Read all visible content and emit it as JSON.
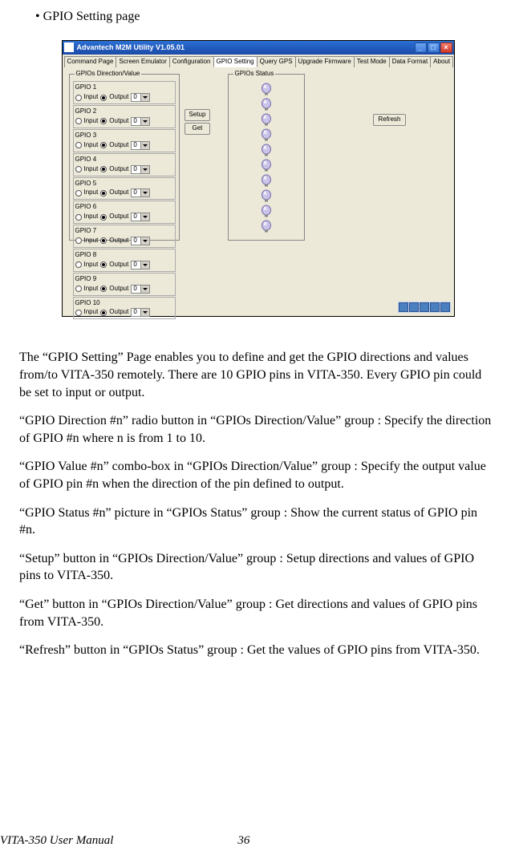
{
  "bullet_heading": "•  GPIO Setting page",
  "window": {
    "title": "Advantech M2M Utility V1.05.01",
    "tabs": [
      "Command Page",
      "Screen Emulator",
      "Configuration",
      "GPIO Setting",
      "Query GPS",
      "Upgrade Firmware",
      "Test Mode",
      "Data Format",
      "About"
    ],
    "active_tab_index": 3,
    "group_direction": {
      "title": "GPIOs Direction/Value",
      "rows": [
        {
          "label": "GPIO 1",
          "input": "Input",
          "output": "Output",
          "value": "0"
        },
        {
          "label": "GPIO 2",
          "input": "Input",
          "output": "Output",
          "value": "0"
        },
        {
          "label": "GPIO 3",
          "input": "Input",
          "output": "Output",
          "value": "0"
        },
        {
          "label": "GPIO 4",
          "input": "Input",
          "output": "Output",
          "value": "0"
        },
        {
          "label": "GPIO 5",
          "input": "Input",
          "output": "Output",
          "value": "0"
        },
        {
          "label": "GPIO 6",
          "input": "Input",
          "output": "Output",
          "value": "0"
        },
        {
          "label": "GPIO 7",
          "input": "Input",
          "output": "Output",
          "value": "0"
        },
        {
          "label": "GPIO 8",
          "input": "Input",
          "output": "Output",
          "value": "0"
        },
        {
          "label": "GPIO 9",
          "input": "Input",
          "output": "Output",
          "value": "0"
        },
        {
          "label": "GPIO 10",
          "input": "Input",
          "output": "Output",
          "value": "0"
        }
      ]
    },
    "setup_label": "Setup",
    "get_label": "Get",
    "group_status": {
      "title": "GPIOs Status"
    },
    "refresh_label": "Refresh"
  },
  "paragraphs": {
    "p1": "The “GPIO Setting” Page enables you to define and get the GPIO direc­tions and values from/to VITA-350 remotely. There are 10 GPIO pins in VITA-350. Every GPIO pin could be set to input or output.",
    "p2": "“GPIO Direction #n” radio button in “GPIOs Direction/Value” group : Specify the direction of GPIO #n where n is from 1 to 10.",
    "p3": "“GPIO Value #n” combo-box in “GPIOs Direction/Value” group : Spec­ify the output value of GPIO pin #n when the direction of the pin defined to output.",
    "p4": "“GPIO Status #n” picture in “GPIOs Status” group : Show the current sta­tus of GPIO pin #n.",
    "p5": "“Setup” button in “GPIOs Direction/Value” group : Setup directions and values of GPIO pins to VITA-350.",
    "p6": "“Get” button in “GPIOs Direction/Value” group : Get directions and val­ues of GPIO pins from VITA-350.",
    "p7": "“Refresh” button in “GPIOs Status” group : Get the values of GPIO pins from VITA-350."
  },
  "footer": {
    "manual": "VITA-350 User Manual",
    "page": "36"
  }
}
